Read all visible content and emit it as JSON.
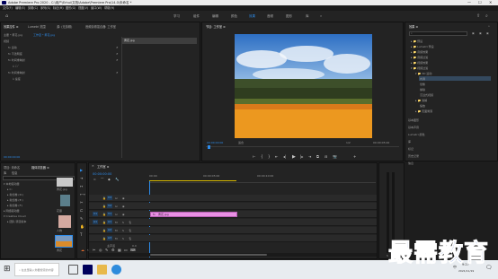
{
  "titlebar": {
    "title": "Adobe Premiere Pro 2020 - C:\\用户\\Erhui\\文档\\Adobe\\Premiere Pro\\14.0\\未命名 *",
    "min": "—",
    "max": "☐",
    "close": "✕"
  },
  "menu": [
    "文件(F)",
    "编辑(E)",
    "剪辑(C)",
    "序列(S)",
    "标记(M)",
    "图形(G)",
    "视图(V)",
    "窗口(W)",
    "帮助(H)"
  ],
  "workspaces": [
    "学习",
    "组件",
    "编辑",
    "颜色",
    "效果",
    "音频",
    "图形",
    "库"
  ],
  "workspaces_overflow": "»",
  "effect_controls": {
    "tabs": [
      "效果控件 ≡",
      "Lumetri 范围",
      "源: (无剪辑)",
      "音频剪辑混合器: 工作室"
    ],
    "source_label": "主要 * 黄花.jpg",
    "sequence_label": "工作室 * 黄花.jpg",
    "rows": [
      "视频",
      "fx 运动",
      "fx 不透明度",
      "fx 时间重映射",
      "ǒ ☐ 𝄒",
      "fx 时间重映射",
      "ò 速度"
    ],
    "clip_tag": "黄花.jpg",
    "timecode": "00:00:00:00"
  },
  "program": {
    "tab": "节目: 工作室 ≡",
    "timecode": "00:00:00:00",
    "fit": "适合",
    "ratio": "完整",
    "fraction": "1/2",
    "duration": "00:00:05:00",
    "controls": [
      "⊢",
      "{",
      "}",
      "⇤",
      "◂|",
      "▶",
      "|▸",
      "⇥",
      "⧉",
      "⊟",
      "📷",
      "+"
    ]
  },
  "effects": {
    "title": "效果 ≡",
    "search_placeholder": "",
    "tree": [
      "预设",
      "Lumetri 预设",
      "音频效果",
      "音频过渡",
      "视频效果",
      "视频过渡",
      "3D 运动",
      "内滑",
      "划像",
      "擦除",
      "沉浸式视频",
      "溶解",
      "缩放",
      "页面剥落"
    ],
    "sections": [
      "基本图形",
      "基本声音",
      "Lumetri 颜色",
      "库",
      "标记",
      "历史记录",
      "信息"
    ]
  },
  "project": {
    "tabs": [
      "项目: 未命名",
      "媒体浏览器 ≡",
      "库",
      "信息"
    ],
    "drive_label": "本地驱动器",
    "tree": [
      "本地驱动器",
      "C:",
      "新加卷 (D:)",
      "新加卷 (E:)",
      "新加卷 (F:)",
      "网络驱动器",
      "Creative Cloud",
      "团队 项目版本"
    ],
    "thumbs": [
      "黄花.jpg",
      "花瓣",
      "人物",
      "黄花"
    ]
  },
  "tools": [
    "▶",
    "⇥",
    "↔",
    "⟷",
    "✂",
    "⊏",
    "✎",
    "✋",
    "T"
  ],
  "timeline": {
    "tab": "工作室 ≡",
    "timecode": "00:00:00:00",
    "ruler": [
      "00:00",
      "00:00:05:00",
      "00:00:10:00"
    ],
    "video_tracks": [
      "V3",
      "V2",
      "V1"
    ],
    "audio_tracks": [
      "A1",
      "A2",
      "A3"
    ],
    "master": "主声道",
    "master_value": "0.0",
    "clip_label": "黄花.jpg"
  },
  "taskbar": {
    "search": "在这里输入你要搜索的内容",
    "time": "9:27",
    "date": "2021/11/19",
    "lang": "中"
  },
  "watermark": "最需教育",
  "colors": {
    "accent": "#2d8ceb",
    "clip": "#e990e4",
    "panel": "#232323",
    "bg": "#1d1d1d"
  }
}
